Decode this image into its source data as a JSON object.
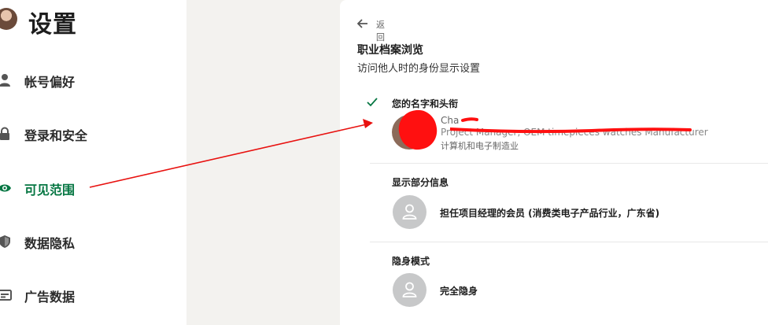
{
  "sidebar": {
    "title": "设置",
    "items": [
      {
        "label": "帐号偏好",
        "icon": "person-icon"
      },
      {
        "label": "登录和安全",
        "icon": "lock-icon"
      },
      {
        "label": "可见范围",
        "icon": "eye-icon",
        "active": true
      },
      {
        "label": "数据隐私",
        "icon": "shield-icon"
      },
      {
        "label": "广告数据",
        "icon": "ad-card-icon"
      }
    ]
  },
  "content": {
    "back_label": "返回",
    "title": "职业档案浏览",
    "subtitle": "访问他人时的身份显示设置",
    "options": [
      {
        "title": "您的名字和头衔",
        "selected": true,
        "name": "Cha",
        "headline": "Project Manager, OEM timepieces watches Manufacturer",
        "industry": "计算机和电子制造业"
      },
      {
        "title": "显示部分信息",
        "selected": false,
        "description": "担任项目经理的会员 (消费类电子产品行业，广东省)"
      },
      {
        "title": "隐身模式",
        "selected": false,
        "description": "完全隐身"
      }
    ]
  },
  "colors": {
    "accent_green": "#057642",
    "annotation_red": "#e8110f"
  }
}
